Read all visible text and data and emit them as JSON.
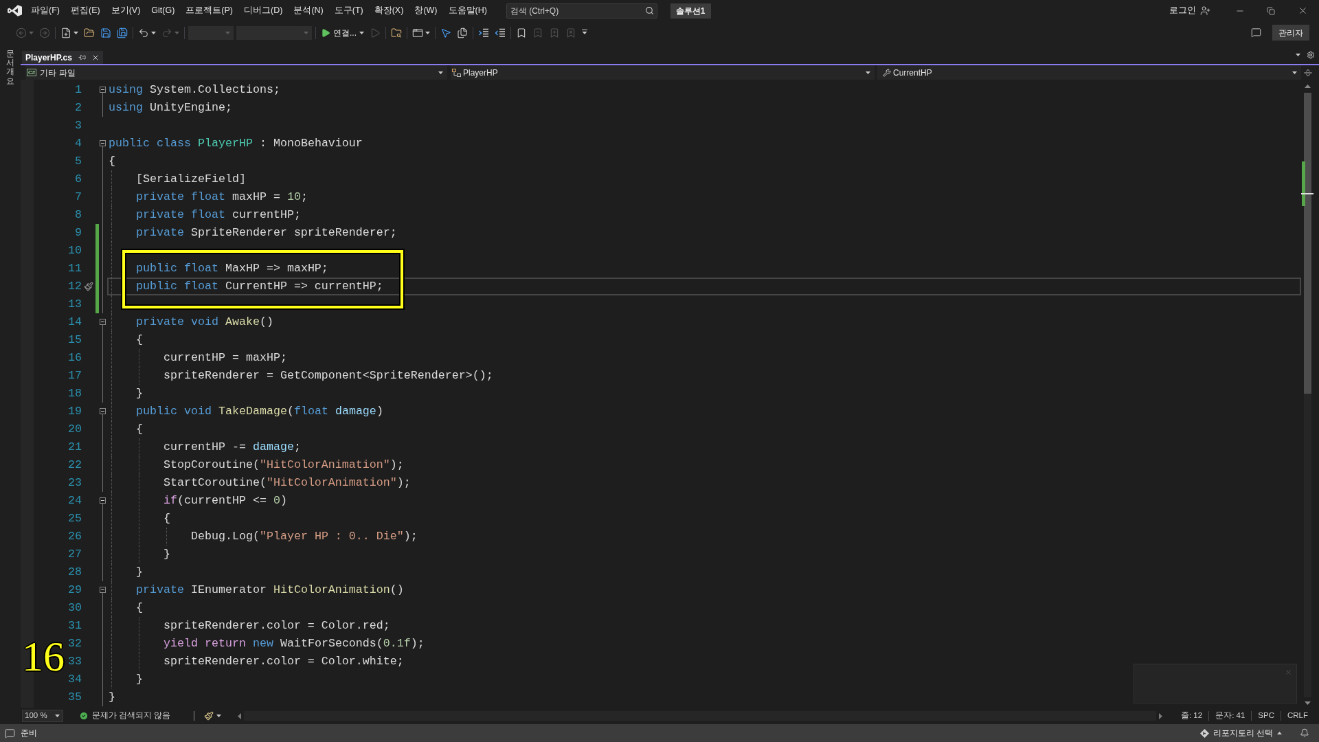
{
  "menu_bar": {
    "items": [
      "파일(F)",
      "편집(E)",
      "보기(V)",
      "Git(G)",
      "프로젝트(P)",
      "디버그(D)",
      "분석(N)",
      "도구(T)",
      "확장(X)",
      "창(W)",
      "도움말(H)"
    ],
    "search": {
      "placeholder": "검색 (Ctrl+Q)"
    },
    "solution": "솔루션1",
    "sign_in": "로그인"
  },
  "toolbar": {
    "groups": [
      [
        {
          "kind": "back",
          "disabled": true,
          "menu": true
        },
        {
          "kind": "forward",
          "disabled": true,
          "menu": false
        }
      ],
      [
        {
          "kind": "new-project",
          "disabled": false,
          "menu": true
        },
        {
          "kind": "open",
          "disabled": false,
          "menu": false
        },
        {
          "kind": "save",
          "disabled": false,
          "menu": false
        },
        {
          "kind": "save-all",
          "disabled": false,
          "menu": false
        }
      ],
      [
        {
          "kind": "undo",
          "disabled": false,
          "menu": true
        },
        {
          "kind": "redo",
          "disabled": true,
          "menu": true
        }
      ],
      [
        {
          "kind": "configuration",
          "disabled": true,
          "menu": true
        },
        {
          "kind": "platform",
          "disabled": true,
          "menu": true
        }
      ],
      [
        {
          "kind": "start",
          "label": "연결...",
          "disabled": false,
          "menu": true
        },
        {
          "kind": "start-without-debugging",
          "disabled": true,
          "menu": false
        }
      ],
      [
        {
          "kind": "browse",
          "disabled": false,
          "menu": false
        }
      ],
      [
        {
          "kind": "layout",
          "disabled": false,
          "menu": true
        }
      ],
      [
        {
          "kind": "step",
          "disabled": false,
          "menu": false
        },
        {
          "kind": "pages",
          "disabled": false,
          "menu": false
        }
      ],
      [
        {
          "kind": "comment",
          "disabled": false,
          "menu": false
        },
        {
          "kind": "uncomment",
          "disabled": false,
          "menu": false
        }
      ],
      [
        {
          "kind": "bookmark",
          "disabled": false,
          "menu": false
        },
        {
          "kind": "bookmark-previous",
          "disabled": true,
          "menu": false
        },
        {
          "kind": "bookmark-next",
          "disabled": true,
          "menu": false
        },
        {
          "kind": "bookmark-clear",
          "disabled": true,
          "menu": false
        },
        {
          "kind": "overflow",
          "disabled": false,
          "menu": false
        }
      ]
    ],
    "role": "관리자"
  },
  "side_tab": "문서 개요",
  "tabs": [
    {
      "label": "PlayerHP.cs",
      "selected": true
    }
  ],
  "nav_bar": {
    "project_badge": "C#",
    "project": "기타 파일",
    "type": "PlayerHP",
    "member": "CurrentHP"
  },
  "code": {
    "lines": [
      {
        "number": "1",
        "tokens": [
          {
            "kind": "keyword",
            "text": "using"
          },
          {
            "kind": "plain",
            "text": " System.Collections;"
          }
        ],
        "collapsible": true,
        "changed": false,
        "current": false,
        "highlighted": false
      },
      {
        "number": "2",
        "tokens": [
          {
            "kind": "keyword",
            "text": "using"
          },
          {
            "kind": "plain",
            "text": " UnityEngine;"
          }
        ],
        "collapsible": false,
        "changed": false,
        "current": false,
        "highlighted": false
      },
      {
        "number": "3",
        "collapsible": false,
        "changed": false,
        "current": false,
        "highlighted": false
      },
      {
        "number": "4",
        "tokens": [
          {
            "kind": "keyword",
            "text": "public class "
          },
          {
            "kind": "type",
            "text": "PlayerHP"
          },
          {
            "kind": "plain",
            "text": " : MonoBehaviour"
          }
        ],
        "collapsible": true,
        "changed": false,
        "current": false,
        "highlighted": false
      },
      {
        "number": "5",
        "tokens": [
          {
            "kind": "plain",
            "text": "{"
          }
        ],
        "collapsible": false,
        "changed": false,
        "current": false,
        "highlighted": false
      },
      {
        "number": "6",
        "tokens": [
          {
            "kind": "plain",
            "text": "    [SerializeField]"
          }
        ],
        "collapsible": false,
        "changed": false,
        "current": false,
        "highlighted": false
      },
      {
        "number": "7",
        "tokens": [
          {
            "kind": "keyword",
            "text": "    private float"
          },
          {
            "kind": "plain",
            "text": " maxHP = "
          },
          {
            "kind": "number",
            "text": "10"
          },
          {
            "kind": "plain",
            "text": ";"
          }
        ],
        "collapsible": false,
        "changed": false,
        "current": false,
        "highlighted": false
      },
      {
        "number": "8",
        "tokens": [
          {
            "kind": "keyword",
            "text": "    private float"
          },
          {
            "kind": "plain",
            "text": " currentHP;"
          }
        ],
        "collapsible": false,
        "changed": false,
        "current": false,
        "highlighted": false
      },
      {
        "number": "9",
        "tokens": [
          {
            "kind": "keyword",
            "text": "    private"
          },
          {
            "kind": "plain",
            "text": " SpriteRenderer spriteRenderer;"
          }
        ],
        "collapsible": false,
        "changed": true,
        "current": false,
        "highlighted": false
      },
      {
        "number": "10",
        "collapsible": false,
        "changed": true,
        "current": false,
        "highlighted": false
      },
      {
        "number": "11",
        "tokens": [
          {
            "kind": "keyword",
            "text": "    public float"
          },
          {
            "kind": "plain",
            "text": " MaxHP => maxHP;"
          }
        ],
        "collapsible": false,
        "changed": true,
        "current": false,
        "highlighted": true
      },
      {
        "number": "12",
        "tokens": [
          {
            "kind": "keyword",
            "text": "    public float"
          },
          {
            "kind": "plain",
            "text": " CurrentHP => currentHP;"
          }
        ],
        "collapsible": false,
        "changed": true,
        "current": true,
        "highlighted": true
      },
      {
        "number": "13",
        "collapsible": false,
        "changed": true,
        "current": false,
        "highlighted": false
      },
      {
        "number": "14",
        "tokens": [
          {
            "kind": "keyword",
            "text": "    private void "
          },
          {
            "kind": "method",
            "text": "Awake"
          },
          {
            "kind": "plain",
            "text": "()"
          }
        ],
        "collapsible": true,
        "changed": false,
        "current": false,
        "highlighted": false
      },
      {
        "number": "15",
        "tokens": [
          {
            "kind": "plain",
            "text": "    {"
          }
        ],
        "collapsible": false,
        "changed": false,
        "current": false,
        "highlighted": false
      },
      {
        "number": "16",
        "tokens": [
          {
            "kind": "plain",
            "text": "        currentHP = maxHP;"
          }
        ],
        "collapsible": false,
        "changed": false,
        "current": false,
        "highlighted": false
      },
      {
        "number": "17",
        "tokens": [
          {
            "kind": "plain",
            "text": "        spriteRenderer = GetComponent<SpriteRenderer>();"
          }
        ],
        "collapsible": false,
        "changed": false,
        "current": false,
        "highlighted": false
      },
      {
        "number": "18",
        "tokens": [
          {
            "kind": "plain",
            "text": "    }"
          }
        ],
        "collapsible": false,
        "changed": false,
        "current": false,
        "highlighted": false
      },
      {
        "number": "19",
        "tokens": [
          {
            "kind": "keyword",
            "text": "    public void "
          },
          {
            "kind": "method",
            "text": "TakeDamage"
          },
          {
            "kind": "plain",
            "text": "("
          },
          {
            "kind": "keyword",
            "text": "float "
          },
          {
            "kind": "parameter",
            "text": "damage"
          },
          {
            "kind": "plain",
            "text": ")"
          }
        ],
        "collapsible": true,
        "changed": false,
        "current": false,
        "highlighted": false
      },
      {
        "number": "20",
        "tokens": [
          {
            "kind": "plain",
            "text": "    {"
          }
        ],
        "collapsible": false,
        "changed": false,
        "current": false,
        "highlighted": false
      },
      {
        "number": "21",
        "tokens": [
          {
            "kind": "plain",
            "text": "        currentHP -= "
          },
          {
            "kind": "parameter",
            "text": "damage"
          },
          {
            "kind": "plain",
            "text": ";"
          }
        ],
        "collapsible": false,
        "changed": false,
        "current": false,
        "highlighted": false
      },
      {
        "number": "22",
        "tokens": [
          {
            "kind": "plain",
            "text": "        StopCoroutine("
          },
          {
            "kind": "string",
            "text": "\"HitColorAnimation\""
          },
          {
            "kind": "plain",
            "text": ");"
          }
        ],
        "collapsible": false,
        "changed": false,
        "current": false,
        "highlighted": false
      },
      {
        "number": "23",
        "tokens": [
          {
            "kind": "plain",
            "text": "        StartCoroutine("
          },
          {
            "kind": "string",
            "text": "\"HitColorAnimation\""
          },
          {
            "kind": "plain",
            "text": ");"
          }
        ],
        "collapsible": false,
        "changed": false,
        "current": false,
        "highlighted": false
      },
      {
        "number": "24",
        "tokens": [
          {
            "kind": "control",
            "text": "        if"
          },
          {
            "kind": "plain",
            "text": "(currentHP <= "
          },
          {
            "kind": "number",
            "text": "0"
          },
          {
            "kind": "plain",
            "text": ")"
          }
        ],
        "collapsible": true,
        "changed": false,
        "current": false,
        "highlighted": false
      },
      {
        "number": "25",
        "tokens": [
          {
            "kind": "plain",
            "text": "        {"
          }
        ],
        "collapsible": false,
        "changed": false,
        "current": false,
        "highlighted": false
      },
      {
        "number": "26",
        "tokens": [
          {
            "kind": "plain",
            "text": "            Debug.Log("
          },
          {
            "kind": "string",
            "text": "\"Player HP : 0.. Die\""
          },
          {
            "kind": "plain",
            "text": ");"
          }
        ],
        "collapsible": false,
        "changed": false,
        "current": false,
        "highlighted": false
      },
      {
        "number": "27",
        "tokens": [
          {
            "kind": "plain",
            "text": "        }"
          }
        ],
        "collapsible": false,
        "changed": false,
        "current": false,
        "highlighted": false
      },
      {
        "number": "28",
        "tokens": [
          {
            "kind": "plain",
            "text": "    }"
          }
        ],
        "collapsible": false,
        "changed": false,
        "current": false,
        "highlighted": false
      },
      {
        "number": "29",
        "tokens": [
          {
            "kind": "keyword",
            "text": "    private"
          },
          {
            "kind": "plain",
            "text": " IEnumerator "
          },
          {
            "kind": "method",
            "text": "HitColorAnimation"
          },
          {
            "kind": "plain",
            "text": "()"
          }
        ],
        "collapsible": true,
        "changed": false,
        "current": false,
        "highlighted": false
      },
      {
        "number": "30",
        "tokens": [
          {
            "kind": "plain",
            "text": "    {"
          }
        ],
        "collapsible": false,
        "changed": false,
        "current": false,
        "highlighted": false
      },
      {
        "number": "31",
        "tokens": [
          {
            "kind": "plain",
            "text": "        spriteRenderer.color = Color.red;"
          }
        ],
        "collapsible": false,
        "changed": false,
        "current": false,
        "highlighted": false
      },
      {
        "number": "32",
        "tokens": [
          {
            "kind": "control",
            "text": "        yield return "
          },
          {
            "kind": "keyword",
            "text": "new"
          },
          {
            "kind": "plain",
            "text": " WaitForSeconds("
          },
          {
            "kind": "number",
            "text": "0.1f"
          },
          {
            "kind": "plain",
            "text": ");"
          }
        ],
        "collapsible": false,
        "changed": false,
        "current": false,
        "highlighted": false
      },
      {
        "number": "33",
        "tokens": [
          {
            "kind": "plain",
            "text": "        spriteRenderer.color = Color.white;"
          }
        ],
        "collapsible": false,
        "changed": false,
        "current": false,
        "highlighted": false
      },
      {
        "number": "34",
        "tokens": [
          {
            "kind": "plain",
            "text": "    }"
          }
        ],
        "collapsible": false,
        "changed": false,
        "current": false,
        "highlighted": false
      },
      {
        "number": "35",
        "tokens": [
          {
            "kind": "plain",
            "text": "}"
          }
        ],
        "collapsible": false,
        "changed": false,
        "current": false,
        "highlighted": false
      }
    ]
  },
  "step_number": "16",
  "editor_status": {
    "zoom": "100 %",
    "issues": "문제가 검색되지 않음",
    "line": "줄: 12",
    "column": "문자: 41",
    "whitespace": "SPC",
    "line_ending": "CRLF"
  },
  "status_bar": {
    "message": "준비",
    "repository": "리포지토리 선택"
  }
}
